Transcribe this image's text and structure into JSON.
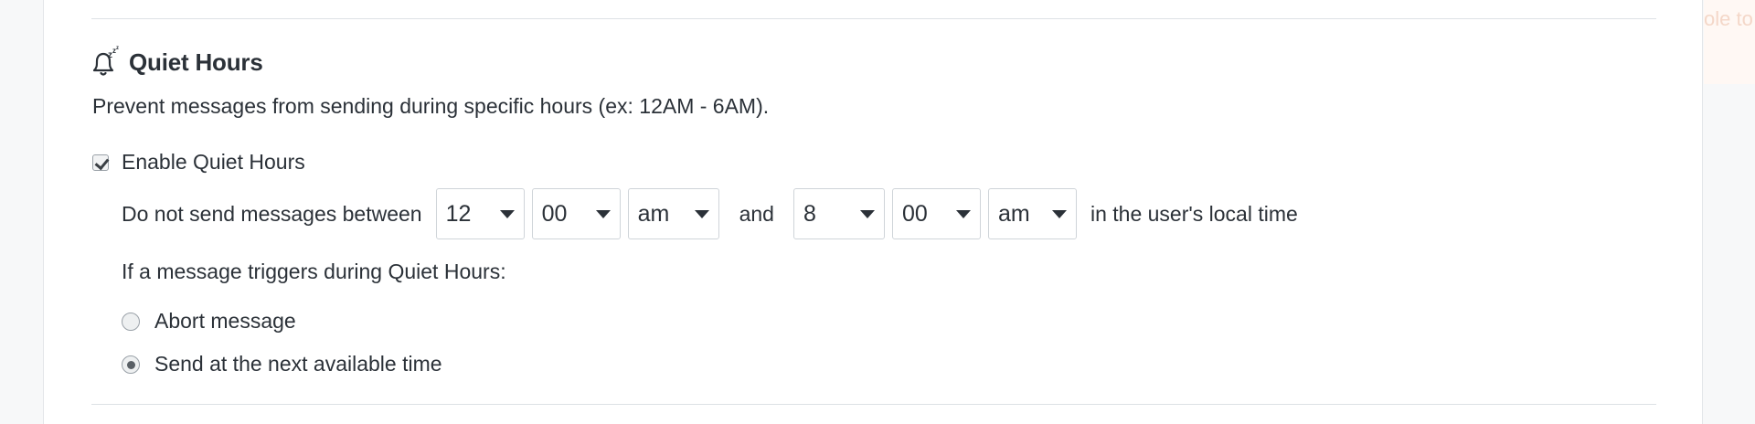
{
  "section": {
    "icon": "quiet-hours-bell-icon",
    "title": "Quiet Hours",
    "description": "Prevent messages from sending during specific hours (ex: 12AM - 6AM)."
  },
  "enable": {
    "label": "Enable Quiet Hours",
    "checked": true
  },
  "schedule": {
    "prefix": "Do not send messages between",
    "start": {
      "hour": "12",
      "minute": "00",
      "ampm": "am"
    },
    "connector": "and",
    "end": {
      "hour": "8",
      "minute": "00",
      "ampm": "am"
    },
    "suffix": "in the user's local time"
  },
  "trigger": {
    "label": "If a message triggers during Quiet Hours:",
    "options": [
      {
        "label": "Abort message",
        "selected": false
      },
      {
        "label": "Send at the next available time",
        "selected": true
      }
    ]
  },
  "offscreen_tooltip": {
    "text": "ole to"
  },
  "colors": {
    "text": "#2b3138",
    "border": "#cfd4d9",
    "divider": "#dde1e5",
    "tooltip_bg": "#fff8f4"
  }
}
